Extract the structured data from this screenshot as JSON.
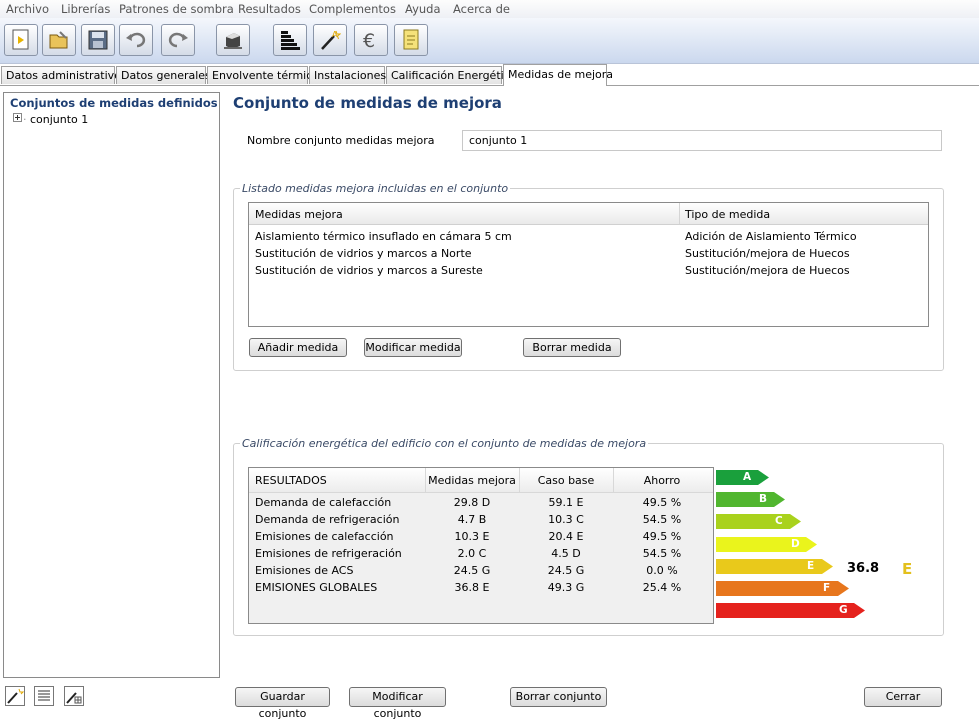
{
  "menu": [
    "Archivo",
    "Librerías",
    "Patrones de sombra",
    "Resultados",
    "Complementos",
    "Ayuda",
    "Acerca de"
  ],
  "tabs": [
    "Datos administrativos",
    "Datos generales",
    "Envolvente térmica",
    "Instalaciones",
    "Calificación Energética",
    "Medidas de mejora"
  ],
  "sidebar": {
    "title": "Conjuntos de medidas definidos",
    "items": [
      "conjunto 1"
    ]
  },
  "main": {
    "title": "Conjunto de medidas de mejora",
    "name_label": "Nombre conjunto medidas mejora",
    "name_value": "conjunto 1",
    "list_group_title": "Listado medidas mejora incluidas en el conjunto",
    "list_headers": [
      "Medidas mejora",
      "Tipo de medida"
    ],
    "list_rows": [
      {
        "medida": "Aislamiento térmico insuflado en cámara 5 cm",
        "tipo": "Adición de Aislamiento Térmico"
      },
      {
        "medida": "Sustitución de vidrios y marcos a Norte",
        "tipo": "Sustitución/mejora de Huecos"
      },
      {
        "medida": "Sustitución de vidrios y marcos a Sureste",
        "tipo": "Sustitución/mejora de Huecos"
      }
    ],
    "list_buttons": [
      "Añadir medida",
      "Modificar medida",
      "Borrar medida"
    ],
    "results_group_title": "Calificación energética del edificio con el conjunto de medidas de mejora",
    "results_headers": [
      "RESULTADOS",
      "Medidas mejora",
      "Caso base",
      "Ahorro"
    ],
    "results_rows": [
      {
        "label": "Demanda de calefacción",
        "mejora": "29.8 D",
        "base": "59.1 E",
        "ahorro": "49.5 %"
      },
      {
        "label": "Demanda de refrigeración",
        "mejora": "4.7 B",
        "base": "10.3 C",
        "ahorro": "54.5 %"
      },
      {
        "label": "Emisiones de calefacción",
        "mejora": "10.3 E",
        "base": "20.4 E",
        "ahorro": "49.5 %"
      },
      {
        "label": "Emisiones de refrigeración",
        "mejora": "2.0 C",
        "base": "4.5 D",
        "ahorro": "54.5 %"
      },
      {
        "label": "Emisiones de ACS",
        "mejora": "24.5 G",
        "base": "24.5 G",
        "ahorro": "0.0 %"
      },
      {
        "label": "EMISIONES GLOBALES",
        "mejora": "36.8 E",
        "base": "49.3 G",
        "ahorro": "25.4 %"
      }
    ],
    "rating_scale": [
      {
        "letter": "A",
        "color": "#1aa03c"
      },
      {
        "letter": "B",
        "color": "#51b62f"
      },
      {
        "letter": "C",
        "color": "#a9d21c"
      },
      {
        "letter": "D",
        "color": "#eaf41c"
      },
      {
        "letter": "E",
        "color": "#e9c91b"
      },
      {
        "letter": "F",
        "color": "#e7761d"
      },
      {
        "letter": "G",
        "color": "#e5221d"
      }
    ],
    "rating_value": "36.8",
    "rating_letter": "E"
  },
  "footer_buttons": [
    "Guardar conjunto",
    "Modificar conjunto",
    "Borrar conjunto",
    "Cerrar"
  ]
}
